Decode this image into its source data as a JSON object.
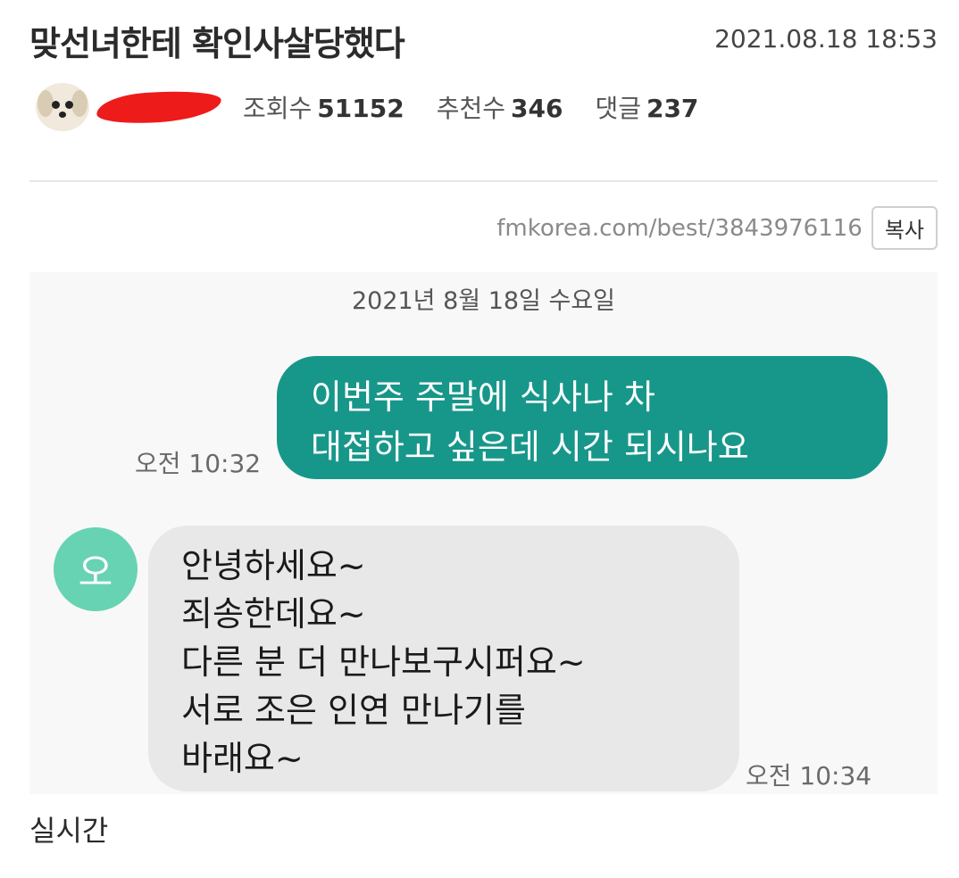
{
  "post": {
    "title": "맞선녀한테 확인사살당했다",
    "date": "2021.08.18 18:53",
    "views_label": "조회수",
    "views_value": "51152",
    "likes_label": "추천수",
    "likes_value": "346",
    "comments_label": "댓글",
    "comments_value": "237",
    "url": "fmkorea.com/best/3843976116",
    "copy_label": "복사"
  },
  "chat": {
    "date_header": "2021년 8월 18일 수요일",
    "outgoing": {
      "lines": [
        "이번주 주말에 식사나 차",
        "대접하고 싶은데 시간 되시나요"
      ],
      "time": "오전 10:32"
    },
    "incoming": {
      "avatar_letter": "오",
      "lines": [
        "안녕하세요~",
        "죄송한데요~",
        "다른 분 더 만나보구시퍼요~",
        "서로 조은 인연 만나기를",
        "바래요~"
      ],
      "time": "오전 10:34"
    }
  },
  "caption": "실시간",
  "colors": {
    "outgoing_bubble": "#17978a",
    "incoming_bubble": "#e8e8e8",
    "contact_avatar": "#67d3b3",
    "redaction": "#ee1b1b"
  }
}
